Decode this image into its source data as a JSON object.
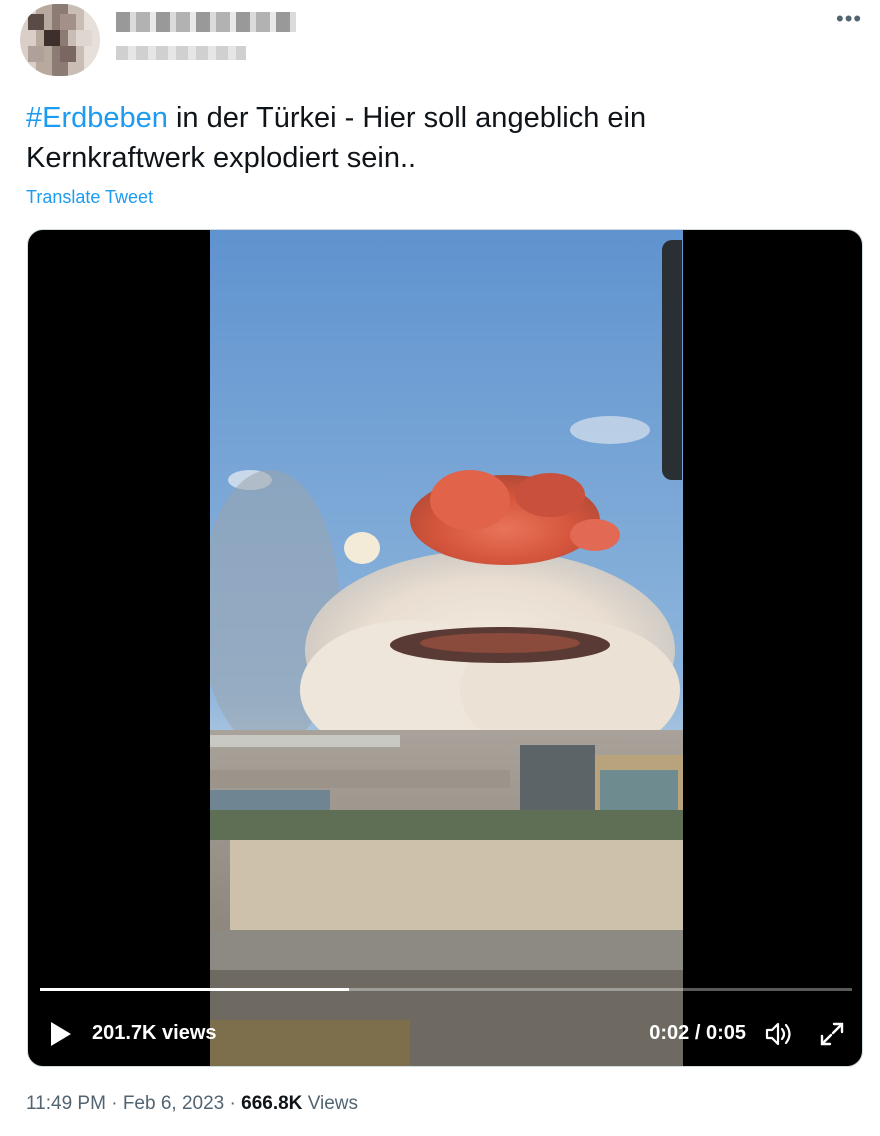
{
  "tweet": {
    "text_hashtag": "#Erdbeben",
    "text_line1_rest": " in der Türkei - Hier soll angeblich ein",
    "text_line2": "Kernkraftwerk explodiert sein..",
    "translate_label": "Translate Tweet"
  },
  "video": {
    "views_label": "201.7K views",
    "time_label": "0:02 / 0:05",
    "progress_fraction": 0.38
  },
  "meta": {
    "time": "11:49 PM",
    "separator": "·",
    "date": "Feb 6, 2023",
    "views_count": "666.8K",
    "views_word": "Views"
  },
  "colors": {
    "accent": "#1d9bf0",
    "text": "#0f1419",
    "muted": "#536471"
  },
  "icons": {
    "more": "more-icon",
    "play": "play-icon",
    "volume": "volume-icon",
    "fullscreen": "fullscreen-icon"
  }
}
